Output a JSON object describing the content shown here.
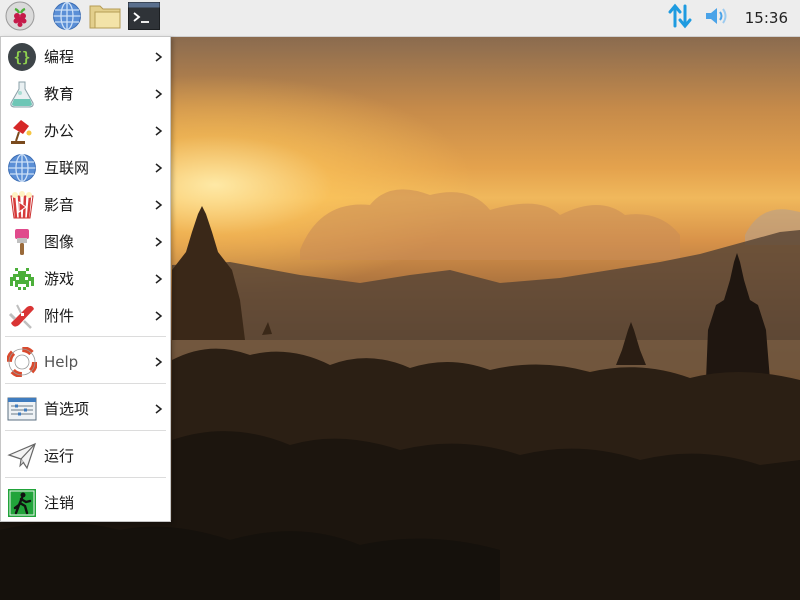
{
  "panel": {
    "clock": "15:36",
    "launchers": [
      {
        "name": "raspberry-menu"
      },
      {
        "name": "web-browser"
      },
      {
        "name": "file-manager"
      },
      {
        "name": "terminal"
      }
    ]
  },
  "menu": {
    "items": [
      {
        "label": "编程",
        "icon": "programming-icon",
        "submenu": true
      },
      {
        "label": "教育",
        "icon": "education-icon",
        "submenu": true
      },
      {
        "label": "办公",
        "icon": "office-icon",
        "submenu": true
      },
      {
        "label": "互联网",
        "icon": "internet-icon",
        "submenu": true
      },
      {
        "label": "影音",
        "icon": "sound-video-icon",
        "submenu": true
      },
      {
        "label": "图像",
        "icon": "graphics-icon",
        "submenu": true
      },
      {
        "label": "游戏",
        "icon": "games-icon",
        "submenu": true
      },
      {
        "label": "附件",
        "icon": "accessories-icon",
        "submenu": true
      },
      {
        "label": "Help",
        "icon": "help-icon",
        "submenu": true
      },
      {
        "label": "首选项",
        "icon": "preferences-icon",
        "submenu": true
      },
      {
        "label": "运行",
        "icon": "run-icon",
        "submenu": false
      },
      {
        "label": "注销",
        "icon": "logout-icon",
        "submenu": false
      }
    ]
  },
  "colors": {
    "panel_bg": "#ededed",
    "network_icon": "#1e9be0",
    "volume_icon": "#4aa3e8"
  }
}
